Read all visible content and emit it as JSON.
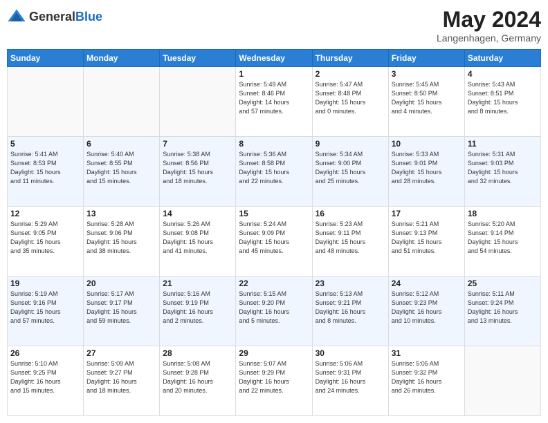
{
  "header": {
    "logo_general": "General",
    "logo_blue": "Blue",
    "month_year": "May 2024",
    "location": "Langenhagen, Germany"
  },
  "days_of_week": [
    "Sunday",
    "Monday",
    "Tuesday",
    "Wednesday",
    "Thursday",
    "Friday",
    "Saturday"
  ],
  "weeks": [
    [
      {
        "day": "",
        "info": ""
      },
      {
        "day": "",
        "info": ""
      },
      {
        "day": "",
        "info": ""
      },
      {
        "day": "1",
        "info": "Sunrise: 5:49 AM\nSunset: 8:46 PM\nDaylight: 14 hours\nand 57 minutes."
      },
      {
        "day": "2",
        "info": "Sunrise: 5:47 AM\nSunset: 8:48 PM\nDaylight: 15 hours\nand 0 minutes."
      },
      {
        "day": "3",
        "info": "Sunrise: 5:45 AM\nSunset: 8:50 PM\nDaylight: 15 hours\nand 4 minutes."
      },
      {
        "day": "4",
        "info": "Sunrise: 5:43 AM\nSunset: 8:51 PM\nDaylight: 15 hours\nand 8 minutes."
      }
    ],
    [
      {
        "day": "5",
        "info": "Sunrise: 5:41 AM\nSunset: 8:53 PM\nDaylight: 15 hours\nand 11 minutes."
      },
      {
        "day": "6",
        "info": "Sunrise: 5:40 AM\nSunset: 8:55 PM\nDaylight: 15 hours\nand 15 minutes."
      },
      {
        "day": "7",
        "info": "Sunrise: 5:38 AM\nSunset: 8:56 PM\nDaylight: 15 hours\nand 18 minutes."
      },
      {
        "day": "8",
        "info": "Sunrise: 5:36 AM\nSunset: 8:58 PM\nDaylight: 15 hours\nand 22 minutes."
      },
      {
        "day": "9",
        "info": "Sunrise: 5:34 AM\nSunset: 9:00 PM\nDaylight: 15 hours\nand 25 minutes."
      },
      {
        "day": "10",
        "info": "Sunrise: 5:33 AM\nSunset: 9:01 PM\nDaylight: 15 hours\nand 28 minutes."
      },
      {
        "day": "11",
        "info": "Sunrise: 5:31 AM\nSunset: 9:03 PM\nDaylight: 15 hours\nand 32 minutes."
      }
    ],
    [
      {
        "day": "12",
        "info": "Sunrise: 5:29 AM\nSunset: 9:05 PM\nDaylight: 15 hours\nand 35 minutes."
      },
      {
        "day": "13",
        "info": "Sunrise: 5:28 AM\nSunset: 9:06 PM\nDaylight: 15 hours\nand 38 minutes."
      },
      {
        "day": "14",
        "info": "Sunrise: 5:26 AM\nSunset: 9:08 PM\nDaylight: 15 hours\nand 41 minutes."
      },
      {
        "day": "15",
        "info": "Sunrise: 5:24 AM\nSunset: 9:09 PM\nDaylight: 15 hours\nand 45 minutes."
      },
      {
        "day": "16",
        "info": "Sunrise: 5:23 AM\nSunset: 9:11 PM\nDaylight: 15 hours\nand 48 minutes."
      },
      {
        "day": "17",
        "info": "Sunrise: 5:21 AM\nSunset: 9:13 PM\nDaylight: 15 hours\nand 51 minutes."
      },
      {
        "day": "18",
        "info": "Sunrise: 5:20 AM\nSunset: 9:14 PM\nDaylight: 15 hours\nand 54 minutes."
      }
    ],
    [
      {
        "day": "19",
        "info": "Sunrise: 5:19 AM\nSunset: 9:16 PM\nDaylight: 15 hours\nand 57 minutes."
      },
      {
        "day": "20",
        "info": "Sunrise: 5:17 AM\nSunset: 9:17 PM\nDaylight: 15 hours\nand 59 minutes."
      },
      {
        "day": "21",
        "info": "Sunrise: 5:16 AM\nSunset: 9:19 PM\nDaylight: 16 hours\nand 2 minutes."
      },
      {
        "day": "22",
        "info": "Sunrise: 5:15 AM\nSunset: 9:20 PM\nDaylight: 16 hours\nand 5 minutes."
      },
      {
        "day": "23",
        "info": "Sunrise: 5:13 AM\nSunset: 9:21 PM\nDaylight: 16 hours\nand 8 minutes."
      },
      {
        "day": "24",
        "info": "Sunrise: 5:12 AM\nSunset: 9:23 PM\nDaylight: 16 hours\nand 10 minutes."
      },
      {
        "day": "25",
        "info": "Sunrise: 5:11 AM\nSunset: 9:24 PM\nDaylight: 16 hours\nand 13 minutes."
      }
    ],
    [
      {
        "day": "26",
        "info": "Sunrise: 5:10 AM\nSunset: 9:25 PM\nDaylight: 16 hours\nand 15 minutes."
      },
      {
        "day": "27",
        "info": "Sunrise: 5:09 AM\nSunset: 9:27 PM\nDaylight: 16 hours\nand 18 minutes."
      },
      {
        "day": "28",
        "info": "Sunrise: 5:08 AM\nSunset: 9:28 PM\nDaylight: 16 hours\nand 20 minutes."
      },
      {
        "day": "29",
        "info": "Sunrise: 5:07 AM\nSunset: 9:29 PM\nDaylight: 16 hours\nand 22 minutes."
      },
      {
        "day": "30",
        "info": "Sunrise: 5:06 AM\nSunset: 9:31 PM\nDaylight: 16 hours\nand 24 minutes."
      },
      {
        "day": "31",
        "info": "Sunrise: 5:05 AM\nSunset: 9:32 PM\nDaylight: 16 hours\nand 26 minutes."
      },
      {
        "day": "",
        "info": ""
      }
    ]
  ]
}
